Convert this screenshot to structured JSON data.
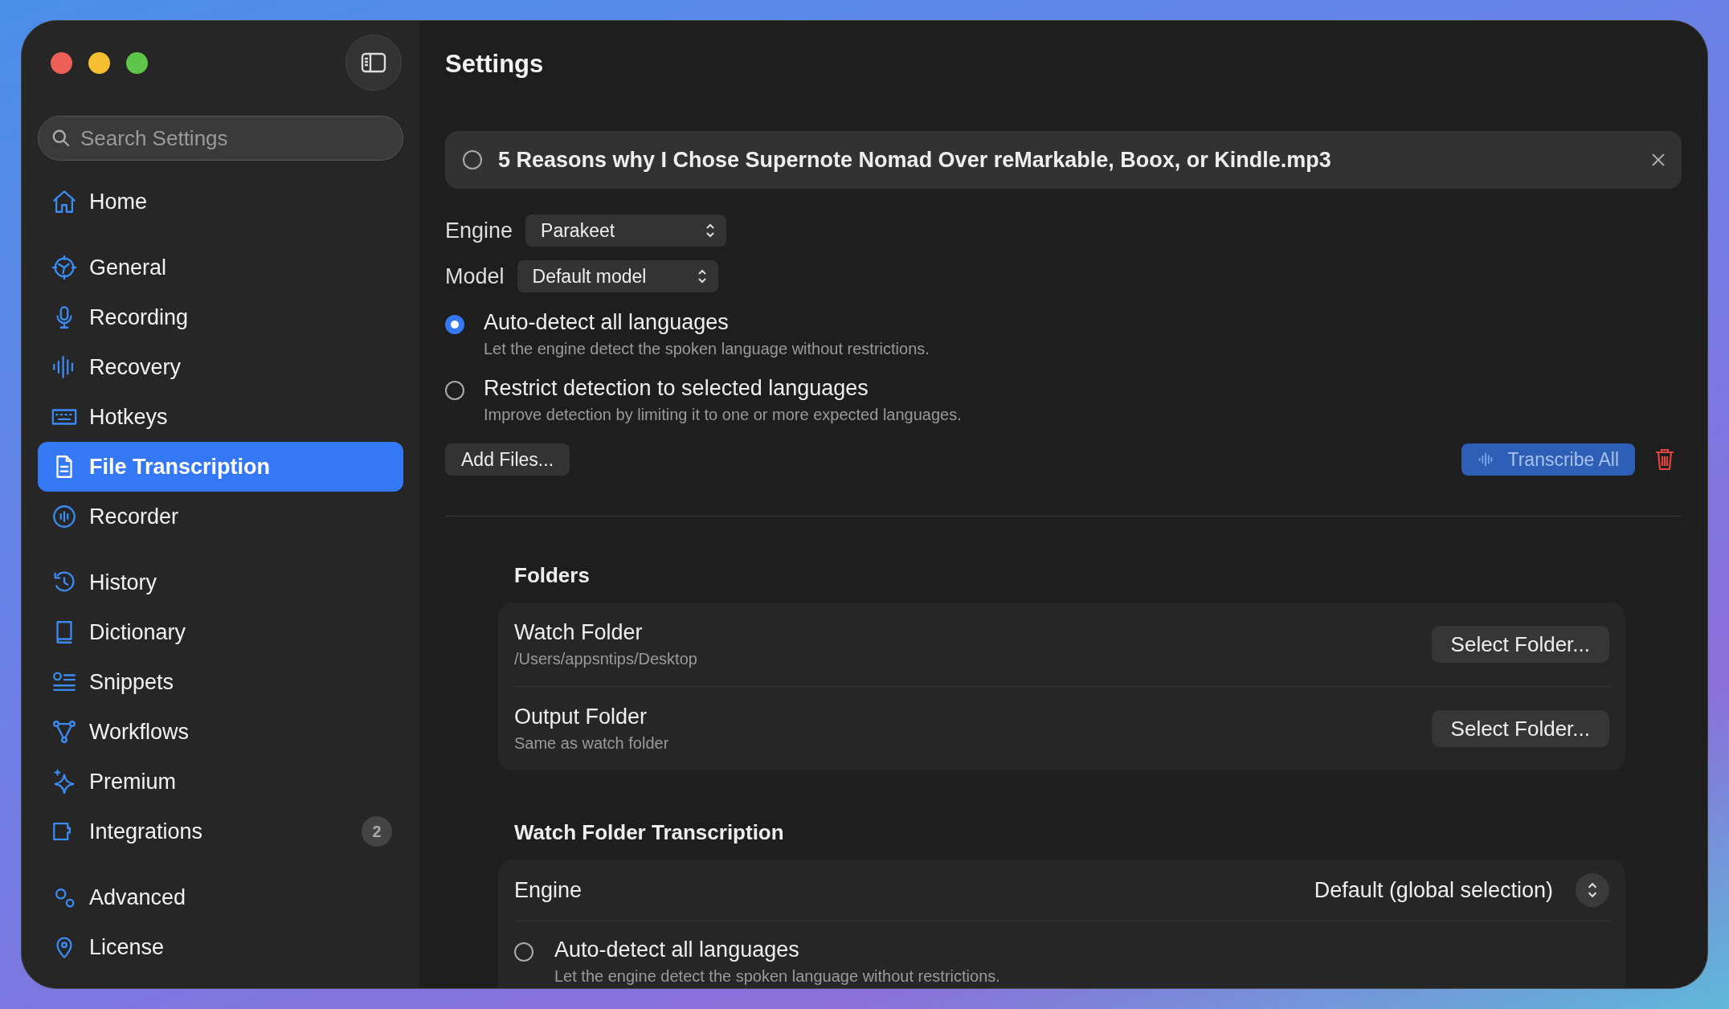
{
  "window": {
    "title": "Settings"
  },
  "sidebar": {
    "search": {
      "placeholder": "Search Settings"
    },
    "sections": [
      {
        "items": [
          {
            "label": "Home",
            "selected": false
          }
        ]
      },
      {
        "items": [
          {
            "label": "General",
            "selected": false
          },
          {
            "label": "Recording",
            "selected": false
          },
          {
            "label": "Recovery",
            "selected": false
          },
          {
            "label": "Hotkeys",
            "selected": false
          },
          {
            "label": "File Transcription",
            "selected": true
          },
          {
            "label": "Recorder",
            "selected": false
          }
        ]
      },
      {
        "items": [
          {
            "label": "History",
            "selected": false
          },
          {
            "label": "Dictionary",
            "selected": false
          },
          {
            "label": "Snippets",
            "selected": false
          },
          {
            "label": "Workflows",
            "selected": false
          },
          {
            "label": "Premium",
            "selected": false
          },
          {
            "label": "Integrations",
            "selected": false,
            "badge": "2"
          }
        ]
      },
      {
        "items": [
          {
            "label": "Advanced",
            "selected": false
          },
          {
            "label": "License",
            "selected": false
          }
        ]
      }
    ]
  },
  "file_item": {
    "name": "5 Reasons why I Chose Supernote Nomad Over reMarkable, Boox, or Kindle.mp3",
    "selected": false
  },
  "selects": [
    {
      "label": "Engine",
      "value": "Parakeet"
    },
    {
      "label": "Model",
      "value": "Default model"
    }
  ],
  "language_options": [
    {
      "title": "Auto-detect all languages",
      "description": "Let the engine detect the spoken language without restrictions.",
      "selected": true
    },
    {
      "title": "Restrict detection to selected languages",
      "description": "Improve detection by limiting it to one or more expected languages.",
      "selected": false
    }
  ],
  "actions": {
    "add_files": "Add Files...",
    "transcribe_all": "Transcribe All"
  },
  "folders": {
    "heading": "Folders",
    "rows": [
      {
        "title": "Watch Folder",
        "subtitle": "/Users/appsntips/Desktop",
        "button": "Select Folder..."
      },
      {
        "title": "Output Folder",
        "subtitle": "Same as watch folder",
        "button": "Select Folder..."
      }
    ]
  },
  "watch_transcription": {
    "heading": "Watch Folder Transcription",
    "engine": {
      "label": "Engine",
      "value": "Default (global selection)"
    },
    "language_options": [
      {
        "title": "Auto-detect all languages",
        "description": "Let the engine detect the spoken language without restrictions.",
        "selected": false
      }
    ]
  }
}
